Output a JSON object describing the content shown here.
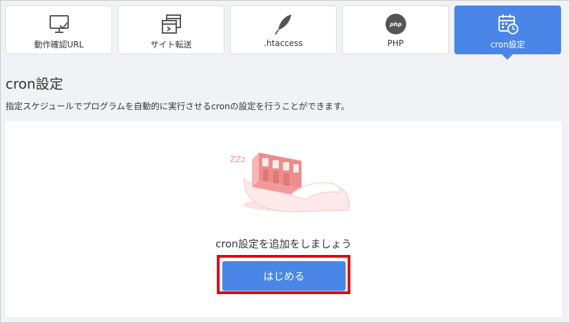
{
  "tabs": [
    {
      "label": "動作確認URL",
      "icon": "monitor-check-icon",
      "active": false
    },
    {
      "label": "サイト転送",
      "icon": "window-redirect-icon",
      "active": false
    },
    {
      "label": ".htaccess",
      "icon": "feather-icon",
      "active": false
    },
    {
      "label": "PHP",
      "icon": "php-icon",
      "icon_text": "php",
      "active": false
    },
    {
      "label": "cron設定",
      "icon": "calendar-clock-icon",
      "active": true
    }
  ],
  "page": {
    "title": "cron設定",
    "description": "指定スケジュールでプログラムを自動的に実行させるcronの設定を行うことができます。"
  },
  "empty_state": {
    "illustration": "sleeping-building-icon",
    "sleep_text": "ZZz",
    "message": "cron設定を追加をしましょう",
    "button_label": "はじめる"
  },
  "colors": {
    "accent": "#4a86e8",
    "highlight": "#e60012",
    "illustration": "#f29a9a",
    "background": "#f1f2f6"
  }
}
